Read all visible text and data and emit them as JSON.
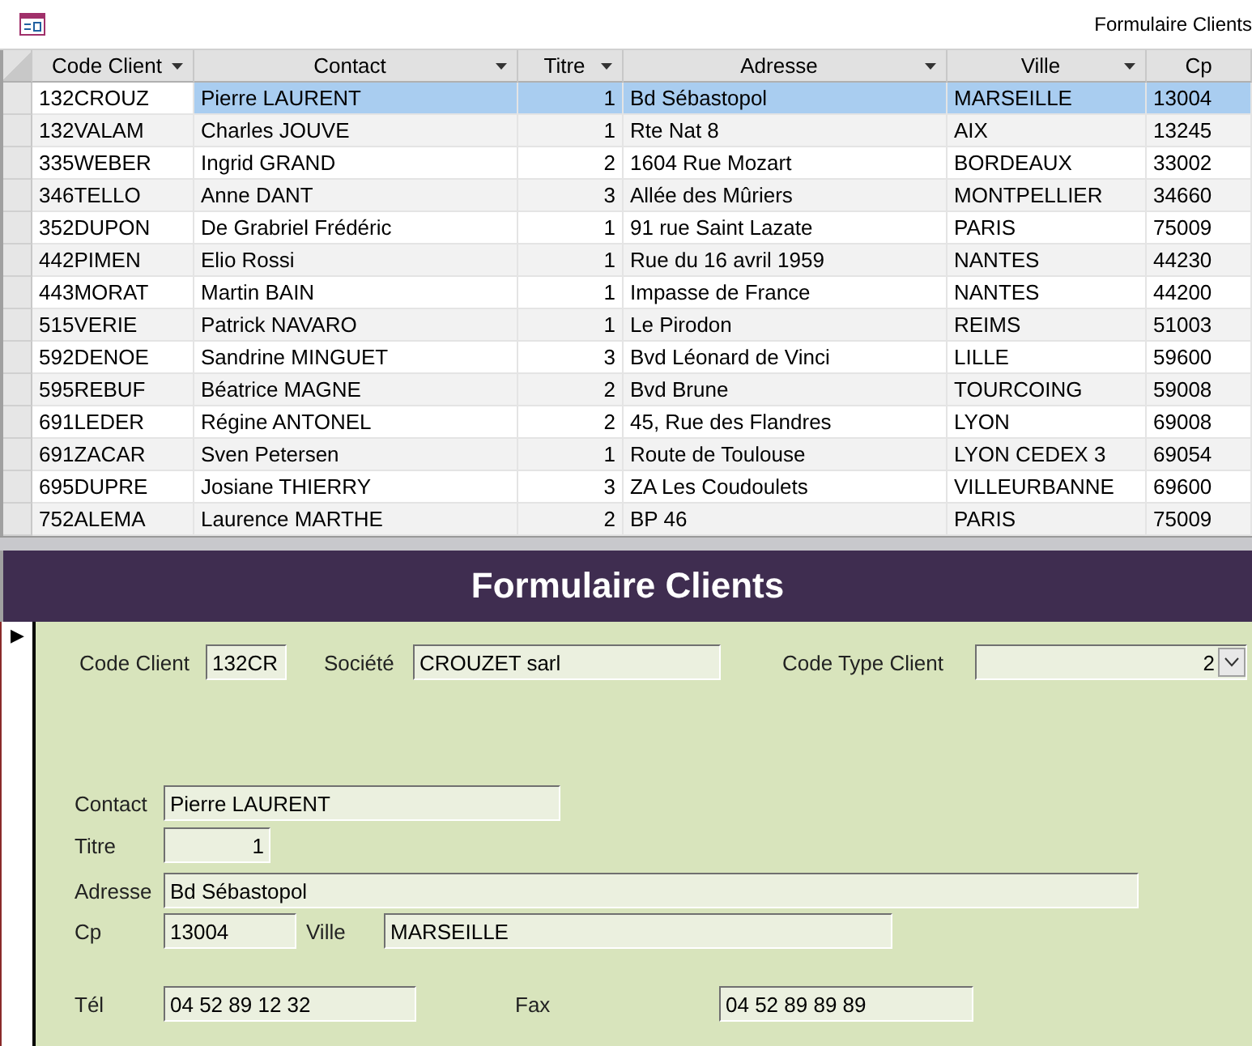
{
  "window": {
    "title": "Formulaire Clients"
  },
  "table": {
    "columns": [
      {
        "label": "Code Client",
        "menu": true,
        "kind": "text"
      },
      {
        "label": "Contact",
        "menu": true,
        "kind": "text"
      },
      {
        "label": "Titre",
        "menu": true,
        "kind": "number"
      },
      {
        "label": "Adresse",
        "menu": true,
        "kind": "text"
      },
      {
        "label": "Ville",
        "menu": true,
        "kind": "text"
      },
      {
        "label": "Cp",
        "menu": false,
        "kind": "text"
      }
    ],
    "rows": [
      {
        "selected": true,
        "cells": [
          "132CROUZ",
          "Pierre LAURENT",
          "1",
          "Bd Sébastopol",
          "MARSEILLE",
          "13004"
        ]
      },
      {
        "selected": false,
        "cells": [
          "132VALAM",
          "Charles JOUVE",
          "1",
          "Rte Nat 8",
          "AIX",
          "13245"
        ]
      },
      {
        "selected": false,
        "cells": [
          "335WEBER",
          "Ingrid GRAND",
          "2",
          "1604 Rue Mozart",
          "BORDEAUX",
          "33002"
        ]
      },
      {
        "selected": false,
        "cells": [
          "346TELLO",
          "Anne DANT",
          "3",
          "Allée des Mûriers",
          "MONTPELLIER",
          "34660"
        ]
      },
      {
        "selected": false,
        "cells": [
          "352DUPON",
          "De Grabriel Frédéric",
          "1",
          "91 rue Saint Lazate",
          "PARIS",
          "75009"
        ]
      },
      {
        "selected": false,
        "cells": [
          "442PIMEN",
          "Elio Rossi",
          "1",
          "Rue du 16 avril 1959",
          "NANTES",
          "44230"
        ]
      },
      {
        "selected": false,
        "cells": [
          "443MORAT",
          "Martin BAIN",
          "1",
          "Impasse de France",
          "NANTES",
          "44200"
        ]
      },
      {
        "selected": false,
        "cells": [
          "515VERIE",
          "Patrick NAVARO",
          "1",
          "Le Pirodon",
          "REIMS",
          "51003"
        ]
      },
      {
        "selected": false,
        "cells": [
          "592DENOE",
          "Sandrine MINGUET",
          "3",
          "Bvd Léonard de Vinci",
          "LILLE",
          "59600"
        ]
      },
      {
        "selected": false,
        "cells": [
          "595REBUF",
          "Béatrice MAGNE",
          "2",
          "Bvd Brune",
          "TOURCOING",
          "59008"
        ]
      },
      {
        "selected": false,
        "cells": [
          "691LEDER",
          "Régine ANTONEL",
          "2",
          "45, Rue des Flandres",
          "LYON",
          "69008"
        ]
      },
      {
        "selected": false,
        "cells": [
          "691ZACAR",
          "Sven Petersen",
          "1",
          "Route de Toulouse",
          "LYON CEDEX 3",
          "69054"
        ]
      },
      {
        "selected": false,
        "cells": [
          "695DUPRE",
          "Josiane THIERRY",
          "3",
          "ZA Les Coudoulets",
          "VILLEURBANNE",
          "69600"
        ]
      },
      {
        "selected": false,
        "cells": [
          "752ALEMA",
          "Laurence MARTHE",
          "2",
          "BP 46",
          "PARIS",
          "75009"
        ]
      }
    ]
  },
  "form": {
    "title": "Formulaire Clients",
    "record_marker": "▶",
    "code_client": {
      "label": "Code Client",
      "value": "132CR"
    },
    "societe": {
      "label": "Société",
      "value": "CROUZET sarl"
    },
    "code_type_client": {
      "label": "Code Type Client",
      "value": "2"
    },
    "contact": {
      "label": "Contact",
      "value": "Pierre LAURENT"
    },
    "titre": {
      "label": "Titre",
      "value": "1"
    },
    "adresse": {
      "label": "Adresse",
      "value": "Bd Sébastopol"
    },
    "cp": {
      "label": "Cp",
      "value": "13004"
    },
    "ville": {
      "label": "Ville",
      "value": "MARSEILLE"
    },
    "tel": {
      "label": "Tél",
      "value": "04 52 89 12 32"
    },
    "fax": {
      "label": "Fax",
      "value": "04 52 89 89 89"
    }
  }
}
